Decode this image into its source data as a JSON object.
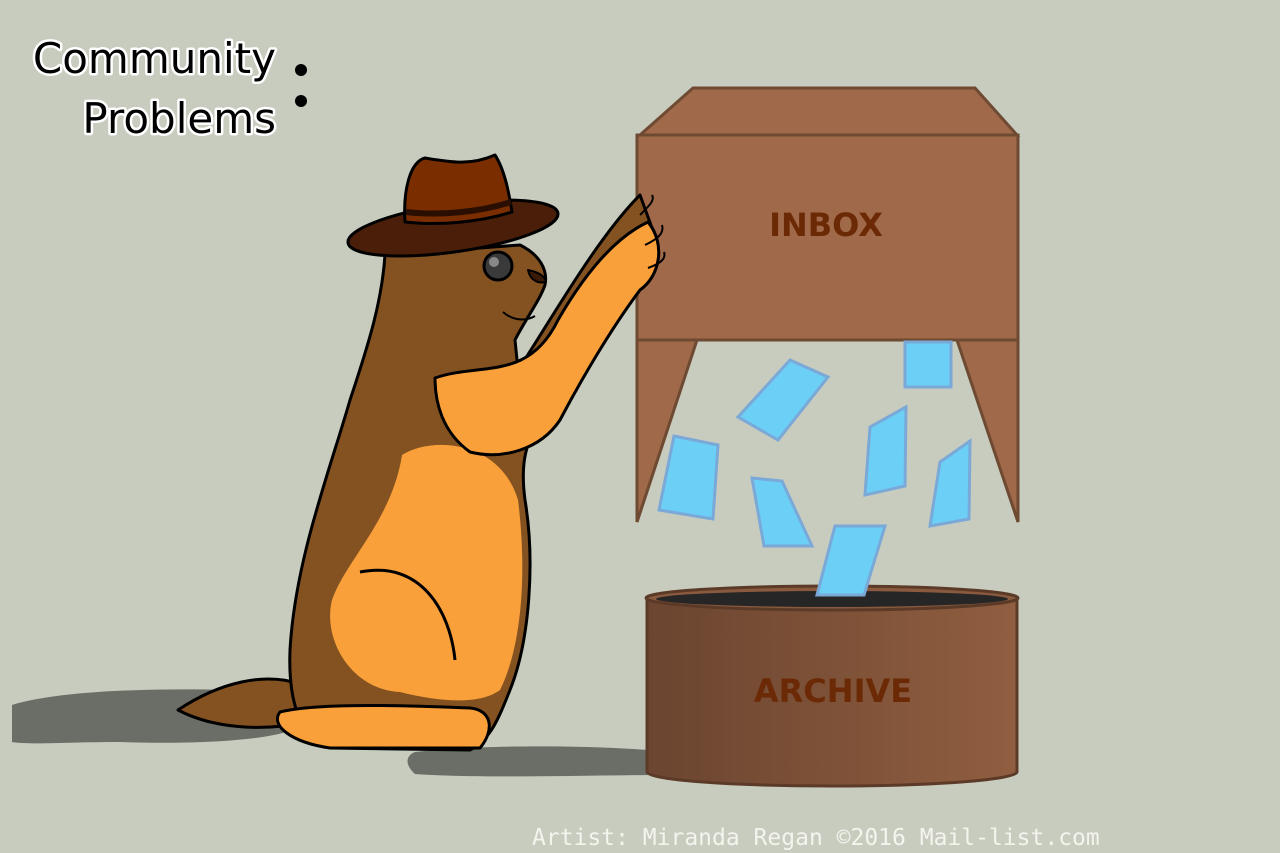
{
  "title": {
    "line1": "Community",
    "line2": "Problems"
  },
  "inbox": {
    "label": "INBOX"
  },
  "archive": {
    "label": "ARCHIVE"
  },
  "credit": "Artist: Miranda Regan ©2016 Mail-list.com",
  "colors": {
    "background": "#c7ccbf",
    "box": "#a0694a",
    "box_outline": "#6e4a33",
    "label_text": "#6b2a05",
    "card": "#6ccff6",
    "card_outline": "#7aa9d8",
    "fur": "#845221",
    "belly": "#f9a03a",
    "hat": "#7a2e00",
    "shadow": "#6b6e66"
  }
}
